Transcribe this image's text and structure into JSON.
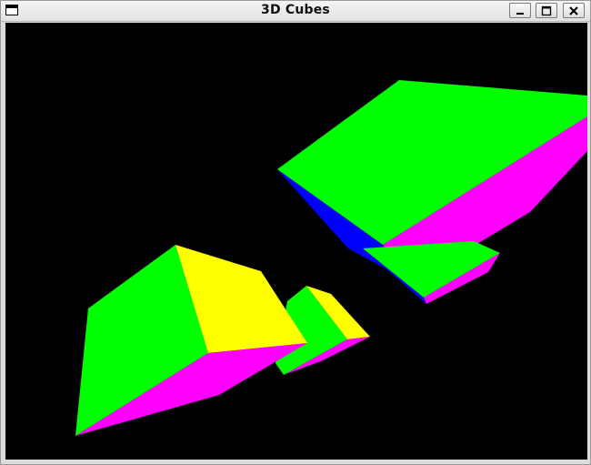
{
  "window": {
    "title": "3D Cubes"
  },
  "title_bar": {
    "icons": {
      "system_menu": "window-menu-icon",
      "minimize": "minimize-icon",
      "maximize": "maximize-icon",
      "close": "close-icon"
    }
  },
  "scene": {
    "background": "#000000",
    "face_colors": {
      "green": "#00ff00",
      "magenta": "#ff00ff",
      "yellow": "#ffff00",
      "blue": "#0000ff"
    }
  }
}
